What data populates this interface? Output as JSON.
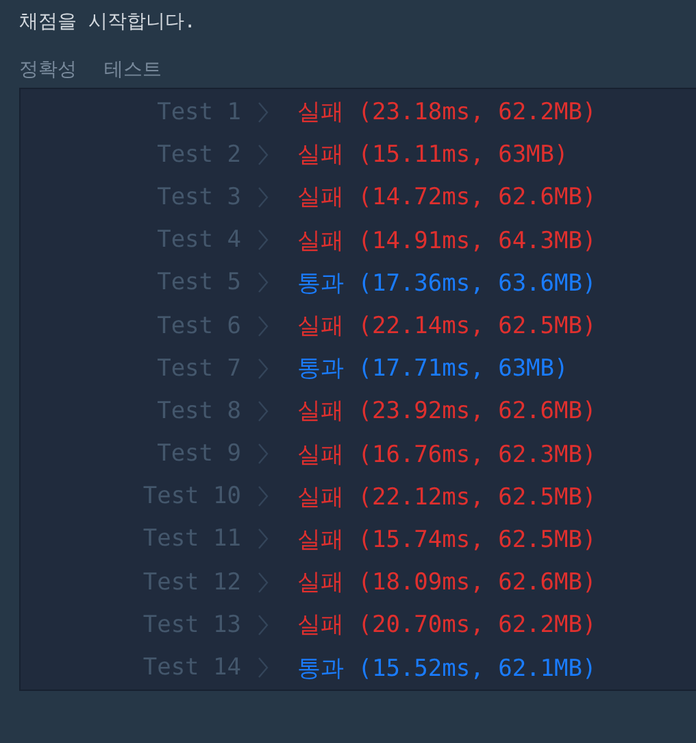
{
  "message": "채점을 시작합니다.",
  "tabs": [
    {
      "label": "정확성",
      "selected": false
    },
    {
      "label": "테스트",
      "selected": false
    }
  ],
  "results": [
    {
      "label": "Test 1",
      "kind": "fail",
      "result": "실패 (23.18ms, 62.2MB)"
    },
    {
      "label": "Test 2",
      "kind": "fail",
      "result": "실패 (15.11ms, 63MB)"
    },
    {
      "label": "Test 3",
      "kind": "fail",
      "result": "실패 (14.72ms, 62.6MB)"
    },
    {
      "label": "Test 4",
      "kind": "fail",
      "result": "실패 (14.91ms, 64.3MB)"
    },
    {
      "label": "Test 5",
      "kind": "pass",
      "result": "통과 (17.36ms, 63.6MB)"
    },
    {
      "label": "Test 6",
      "kind": "fail",
      "result": "실패 (22.14ms, 62.5MB)"
    },
    {
      "label": "Test 7",
      "kind": "pass",
      "result": "통과 (17.71ms, 63MB)"
    },
    {
      "label": "Test 8",
      "kind": "fail",
      "result": "실패 (23.92ms, 62.6MB)"
    },
    {
      "label": "Test 9",
      "kind": "fail",
      "result": "실패 (16.76ms, 62.3MB)"
    },
    {
      "label": "Test 10",
      "kind": "fail",
      "result": "실패 (22.12ms, 62.5MB)"
    },
    {
      "label": "Test 11",
      "kind": "fail",
      "result": "실패 (15.74ms, 62.5MB)"
    },
    {
      "label": "Test 12",
      "kind": "fail",
      "result": "실패 (18.09ms, 62.6MB)"
    },
    {
      "label": "Test 13",
      "kind": "fail",
      "result": "실패 (20.70ms, 62.2MB)"
    },
    {
      "label": "Test 14",
      "kind": "pass",
      "result": "통과 (15.52ms, 62.1MB)"
    }
  ]
}
